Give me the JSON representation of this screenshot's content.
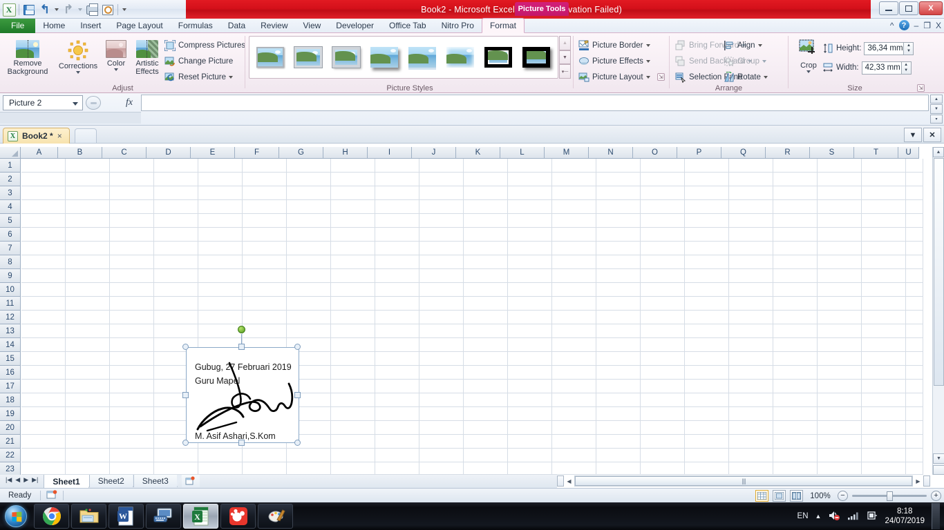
{
  "titlebar": {
    "title": "Book2  -  Microsoft Excel (Product Activation Failed)",
    "contextual_tab": "Picture Tools",
    "quick_access": [
      {
        "name": "excel-logo",
        "label": "X"
      },
      {
        "name": "save",
        "label": "Save"
      },
      {
        "name": "undo",
        "label": "Undo"
      },
      {
        "name": "redo",
        "label": "Redo"
      },
      {
        "name": "print",
        "label": "Quick Print"
      },
      {
        "name": "print-preview",
        "label": "Print Preview"
      },
      {
        "name": "customize-qat",
        "label": "Customize Quick Access Toolbar"
      }
    ],
    "window_buttons": {
      "minimize": "",
      "restore": "",
      "close": "X"
    }
  },
  "tabs": [
    {
      "label": "File",
      "active": false
    },
    {
      "label": "Home",
      "active": false
    },
    {
      "label": "Insert",
      "active": false
    },
    {
      "label": "Page Layout",
      "active": false
    },
    {
      "label": "Formulas",
      "active": false
    },
    {
      "label": "Data",
      "active": false
    },
    {
      "label": "Review",
      "active": false
    },
    {
      "label": "View",
      "active": false
    },
    {
      "label": "Developer",
      "active": false
    },
    {
      "label": "Office Tab",
      "active": false
    },
    {
      "label": "Nitro Pro",
      "active": false
    },
    {
      "label": "Format",
      "active": true
    }
  ],
  "ribbon_right": {
    "minimize_ribbon": "^",
    "help": "?",
    "restore_window": "",
    "close_window": "X"
  },
  "ribbon": {
    "adjust": {
      "group_label": "Adjust",
      "remove_background": "Remove\nBackground",
      "remove_background_line1": "Remove",
      "remove_background_line2": "Background",
      "corrections": "Corrections",
      "color": "Color",
      "artistic_effects_line1": "Artistic",
      "artistic_effects_line2": "Effects",
      "compress_pictures": "Compress Pictures",
      "change_picture": "Change Picture",
      "reset_picture": "Reset Picture"
    },
    "picture_styles": {
      "group_label": "Picture Styles",
      "thumbnails": [
        {
          "name": "simple-frame-white",
          "style": "f-simple"
        },
        {
          "name": "beveled-matte-white",
          "style": "f-beveled"
        },
        {
          "name": "metal-frame",
          "style": "f-thick"
        },
        {
          "name": "drop-shadow-rectangle",
          "style": "f-shadow"
        },
        {
          "name": "reflected-rounded-rectangle",
          "style": "f-reflect"
        },
        {
          "name": "soft-edge-rectangle",
          "style": "f-soft"
        },
        {
          "name": "double-frame-black",
          "style": "f-blackwhite"
        },
        {
          "name": "thick-matte-black",
          "style": "f-black"
        }
      ],
      "scroll_up": "▲",
      "scroll_down": "▼",
      "more": "▼"
    },
    "arrange": {
      "group_label": "Arrange",
      "picture_border": "Picture Border",
      "picture_effects": "Picture Effects",
      "picture_layout": "Picture Layout",
      "bring_forward": "Bring Forward",
      "send_backward": "Send Backward",
      "selection_pane": "Selection Pane",
      "align": "Align",
      "group": "Group",
      "rotate": "Rotate"
    },
    "size": {
      "group_label": "Size",
      "crop": "Crop",
      "height_label": "Height:",
      "height_value": "36,34 mm",
      "width_label": "Width:",
      "width_value": "42,33 mm"
    }
  },
  "formula_bar": {
    "name_box_value": "Picture 2",
    "formula_value": "",
    "fx_label": "fx"
  },
  "office_tab": {
    "tab_label": "Book2 *",
    "close_tab": "×",
    "dropdown": "▼",
    "close_bar": "✕"
  },
  "grid": {
    "columns": [
      "A",
      "B",
      "C",
      "D",
      "E",
      "F",
      "G",
      "H",
      "I",
      "J",
      "K",
      "L",
      "M",
      "N",
      "O",
      "P",
      "Q",
      "R",
      "S",
      "T",
      "U"
    ],
    "rows": [
      1,
      2,
      3,
      4,
      5,
      6,
      7,
      8,
      9,
      10,
      11,
      12,
      13,
      14,
      15,
      16,
      17,
      18,
      19,
      20,
      21,
      22,
      23
    ]
  },
  "picture": {
    "line1": "Gubug, 27 Februari 2019",
    "line2": "Guru Mapel",
    "line3": "M. Asif Ashari,S.Kom",
    "signature_alt": "handwritten signature"
  },
  "sheet_tabs": {
    "nav_first": "|◀",
    "nav_prev": "◀",
    "nav_next": "▶",
    "nav_last": "▶|",
    "sheets": [
      {
        "label": "Sheet1",
        "active": true
      },
      {
        "label": "Sheet2",
        "active": false
      },
      {
        "label": "Sheet3",
        "active": false
      }
    ],
    "insert_sheet": "insert-worksheet"
  },
  "status_bar": {
    "status": "Ready",
    "zoom_percent": "100%",
    "views": [
      {
        "name": "normal-view",
        "active": true
      },
      {
        "name": "page-layout-view",
        "active": false
      },
      {
        "name": "page-break-preview",
        "active": false
      }
    ],
    "zoom_out": "−",
    "zoom_in": "+"
  },
  "taskbar": {
    "start": "start-orb",
    "items": [
      {
        "name": "chrome",
        "label": "Google Chrome"
      },
      {
        "name": "file-explorer",
        "label": "Windows Explorer"
      },
      {
        "name": "word",
        "label": "Microsoft Word"
      },
      {
        "name": "remote-desktop",
        "label": "Remote Desktop"
      },
      {
        "name": "excel",
        "label": "Microsoft Excel",
        "active": true
      },
      {
        "name": "gom-player",
        "label": "GOM Player"
      },
      {
        "name": "paint",
        "label": "Paint"
      }
    ],
    "tray": {
      "language": "EN",
      "show_hidden": "▲",
      "volume": "muted-speaker",
      "network": "network-signal",
      "power": "battery-plug",
      "time": "8:18",
      "date": "24/07/2019"
    }
  }
}
